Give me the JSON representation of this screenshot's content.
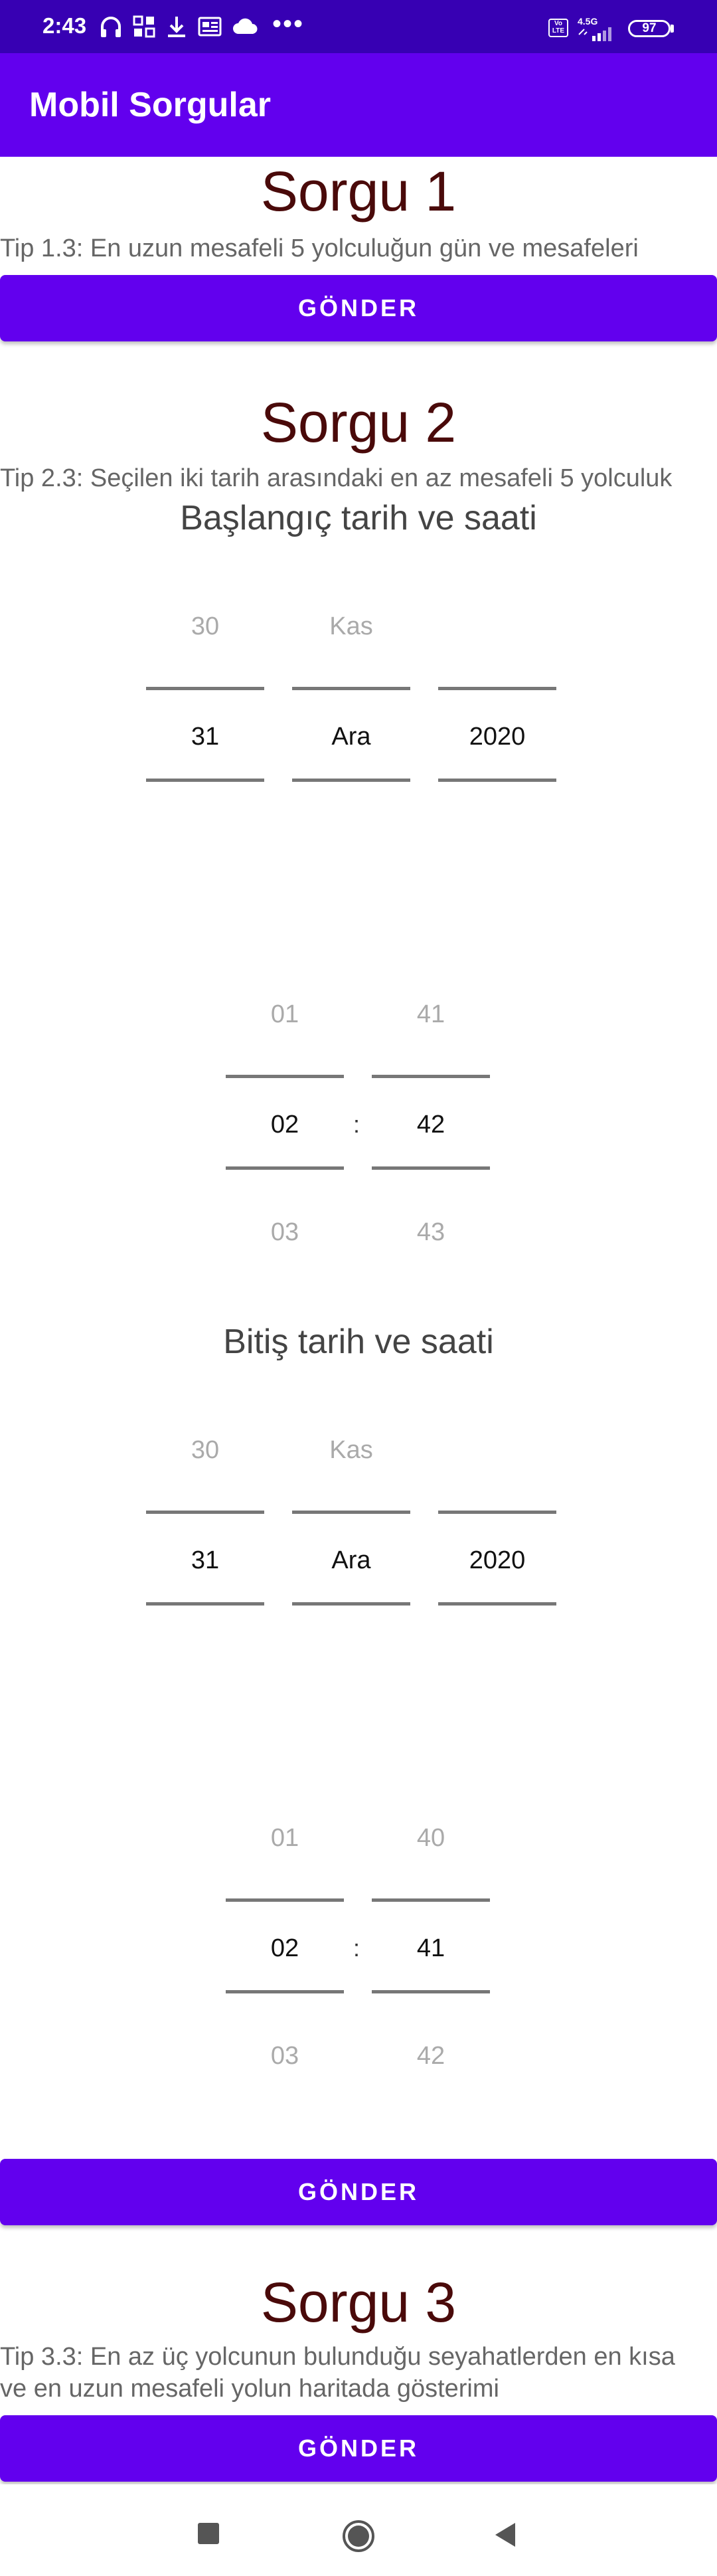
{
  "status_bar": {
    "time": "2:43",
    "more": "•••",
    "network": "4.5G",
    "volte": "Vo LTE",
    "battery": "97"
  },
  "app_bar": {
    "title": "Mobil Sorgular"
  },
  "sorgu1": {
    "title": "Sorgu 1",
    "tip": "Tip 1.3: En uzun mesafeli 5 yolculuğun gün ve mesafeleri",
    "button": "GÖNDER"
  },
  "sorgu2": {
    "title": "Sorgu 2",
    "tip": "Tip 2.3: Seçilen iki tarih arasındaki en az mesafeli 5 yolculuk",
    "start_label": "Başlangıç tarih ve saati",
    "start_date": {
      "day_prev": "30",
      "month_prev": "Kas",
      "day": "31",
      "month": "Ara",
      "year": "2020"
    },
    "start_time": {
      "hour_prev": "01",
      "hour": "02",
      "hour_next": "03",
      "min_prev": "41",
      "min": "42",
      "min_next": "43",
      "sep": ":"
    },
    "end_label": "Bitiş tarih ve saati",
    "end_date": {
      "day_prev": "30",
      "month_prev": "Kas",
      "day": "31",
      "month": "Ara",
      "year": "2020"
    },
    "end_time": {
      "hour_prev": "01",
      "hour": "02",
      "hour_next": "03",
      "min_prev": "40",
      "min": "41",
      "min_next": "42",
      "sep": ":"
    },
    "button": "GÖNDER"
  },
  "sorgu3": {
    "title": "Sorgu 3",
    "tip": "Tip 3.3: En az üç yolcunun bulunduğu seyahatlerden en kısa ve en uzun mesafeli yolun haritada gösterimi",
    "button": "GÖNDER"
  },
  "colors": {
    "status_bar": "#3700b3",
    "primary": "#6200ee",
    "heading": "#4a0a0a"
  }
}
